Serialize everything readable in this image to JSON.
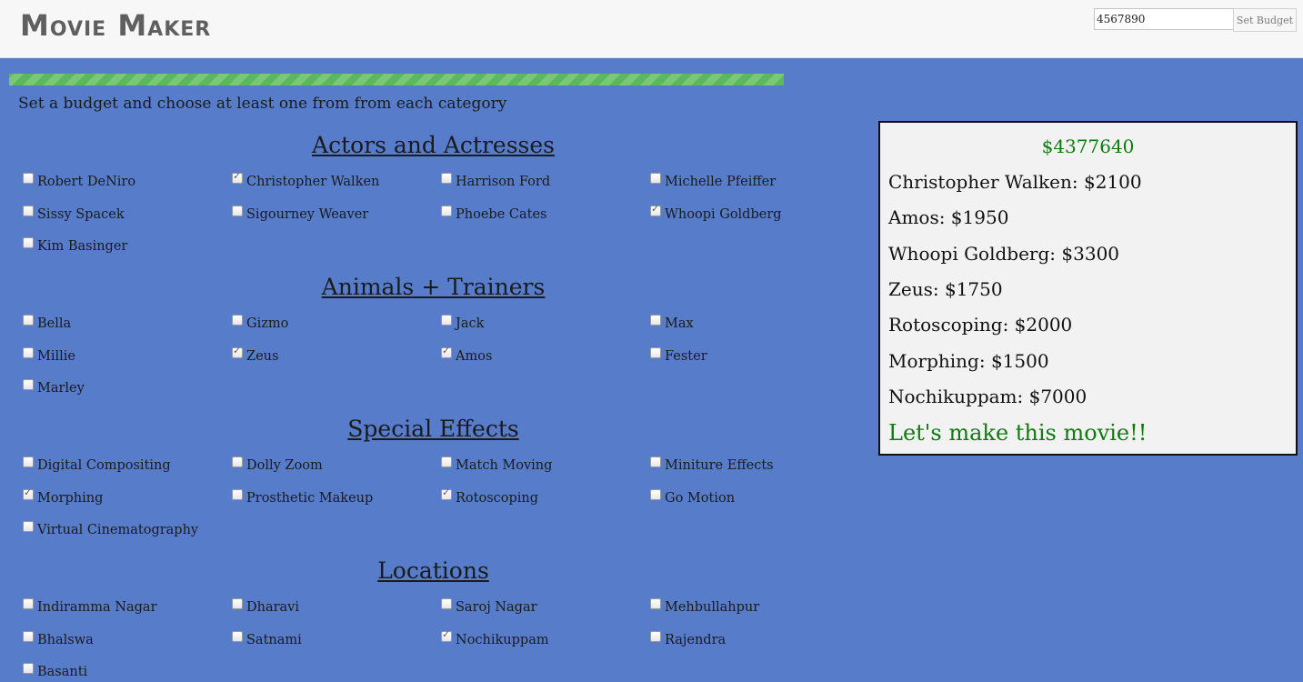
{
  "header": {
    "app_title": "Movie Maker",
    "budget_value": "4567890",
    "set_budget_label": "Set Budget"
  },
  "progress_fraction": 1.0,
  "instructions": "Set a budget and choose at least one from from each category",
  "sections": [
    {
      "title": "Actors and Actresses",
      "options": [
        {
          "label": "Robert DeNiro",
          "checked": false
        },
        {
          "label": "Christopher Walken",
          "checked": true
        },
        {
          "label": "Harrison Ford",
          "checked": false
        },
        {
          "label": "Michelle Pfeiffer",
          "checked": false
        },
        {
          "label": "Sissy Spacek",
          "checked": false
        },
        {
          "label": "Sigourney Weaver",
          "checked": false
        },
        {
          "label": "Phoebe Cates",
          "checked": false
        },
        {
          "label": "Whoopi Goldberg",
          "checked": true
        },
        {
          "label": "Kim Basinger",
          "checked": false
        }
      ]
    },
    {
      "title": "Animals + Trainers",
      "options": [
        {
          "label": "Bella",
          "checked": false
        },
        {
          "label": "Gizmo",
          "checked": false
        },
        {
          "label": "Jack",
          "checked": false
        },
        {
          "label": "Max",
          "checked": false
        },
        {
          "label": "Millie",
          "checked": false
        },
        {
          "label": "Zeus",
          "checked": true
        },
        {
          "label": "Amos",
          "checked": true
        },
        {
          "label": "Fester",
          "checked": false
        },
        {
          "label": "Marley",
          "checked": false
        }
      ]
    },
    {
      "title": "Special Effects",
      "options": [
        {
          "label": "Digital Compositing",
          "checked": false
        },
        {
          "label": "Dolly Zoom",
          "checked": false
        },
        {
          "label": "Match Moving",
          "checked": false
        },
        {
          "label": "Miniture Effects",
          "checked": false
        },
        {
          "label": "Morphing",
          "checked": true
        },
        {
          "label": "Prosthetic Makeup",
          "checked": false
        },
        {
          "label": "Rotoscoping",
          "checked": true
        },
        {
          "label": "Go Motion",
          "checked": false
        },
        {
          "label": "Virtual Cinematography",
          "checked": false
        }
      ]
    },
    {
      "title": "Locations",
      "options": [
        {
          "label": "Indiramma Nagar",
          "checked": false
        },
        {
          "label": "Dharavi",
          "checked": false
        },
        {
          "label": "Saroj Nagar",
          "checked": false
        },
        {
          "label": "Mehbullahpur",
          "checked": false
        },
        {
          "label": "Bhalswa",
          "checked": false
        },
        {
          "label": "Satnami",
          "checked": false
        },
        {
          "label": "Nochikuppam",
          "checked": true
        },
        {
          "label": "Rajendra",
          "checked": false
        },
        {
          "label": "Basanti",
          "checked": false
        }
      ]
    }
  ],
  "summary": {
    "remaining_total": "$4377640",
    "lines": [
      "Christopher Walken: $2100",
      "Amos: $1950",
      "Whoopi Goldberg: $3300",
      "Zeus: $1750",
      "Rotoscoping: $2000",
      "Morphing: $1500",
      "Nochikuppam: $7000"
    ],
    "cta": "Let's make this movie!!"
  },
  "colors": {
    "page_background": "#567cca",
    "progress_green": "#5cb85c",
    "summary_green": "#0e7a0e"
  }
}
